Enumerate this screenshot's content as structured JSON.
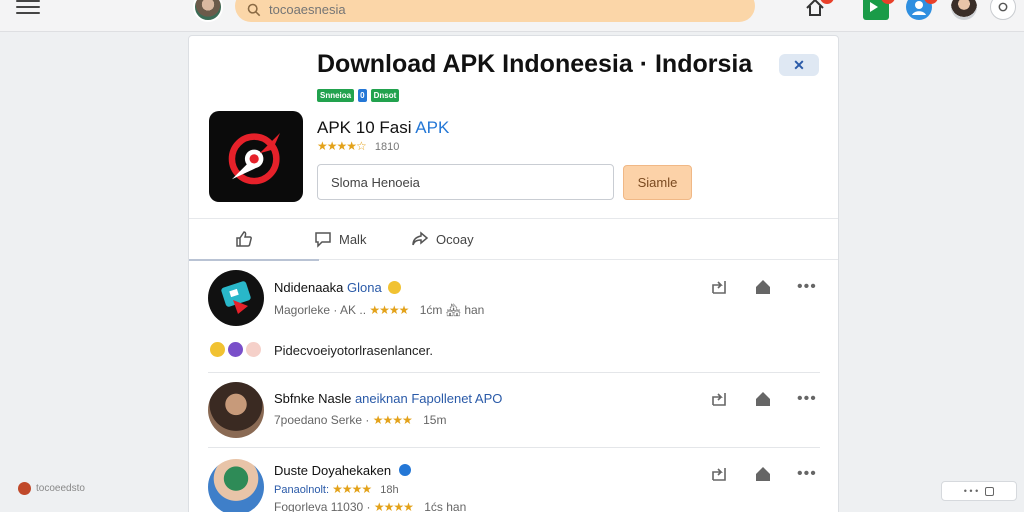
{
  "top_bar": {
    "search_placeholder": "tocoaesnesia",
    "notification_badge": "2",
    "green_badge": "17",
    "profile_badge": "1"
  },
  "app_page": {
    "title": "Download APK Indoneesia · Indorsia",
    "close_label": "✕",
    "tags": [
      "Snneioa",
      "0",
      "Dnsot"
    ],
    "app_name": "APK 10 Fasi",
    "app_name_accent": "APK",
    "app_stars": "★★★★☆",
    "app_rating_count": "1810",
    "input_value": "Sloma Henoeia",
    "submit_label": "Siamle"
  },
  "actions": {
    "like_label": "",
    "comment_label": "Malk",
    "share_label": "Ocoay"
  },
  "posts": [
    {
      "name": "Ndidenaaka",
      "name_accent": "Glona",
      "meta_prefix": "Magorleke · AK .. ",
      "stars": "★★★★",
      "time": "1ćm",
      "extra": "🏘 han",
      "text": "Pidecvoeiyotorlrasenlancer."
    },
    {
      "name": "Sbfnke Nasle",
      "name_accent": "aneiknan Fapollenet APO",
      "meta_prefix": "7poedano Serke · ",
      "stars": "★★★★",
      "time": "15m",
      "extra": ""
    },
    {
      "name": "Duste Doyahekaken",
      "name_accent": "",
      "meta_prefix": "Panaolnolt: ",
      "stars": "★★★★",
      "time": "18h",
      "meta2_prefix": "Fogorleva 11030 · ",
      "time2": "1ćs",
      "extra": "han"
    }
  ],
  "footer": {
    "left_text": "tocoeedsto",
    "right_text": "• • •"
  },
  "colors": {
    "search_bg": "#fbd6a8",
    "accent_blue": "#2477d6",
    "star": "#e3a21a",
    "submit_bg": "#fcd2a8"
  }
}
